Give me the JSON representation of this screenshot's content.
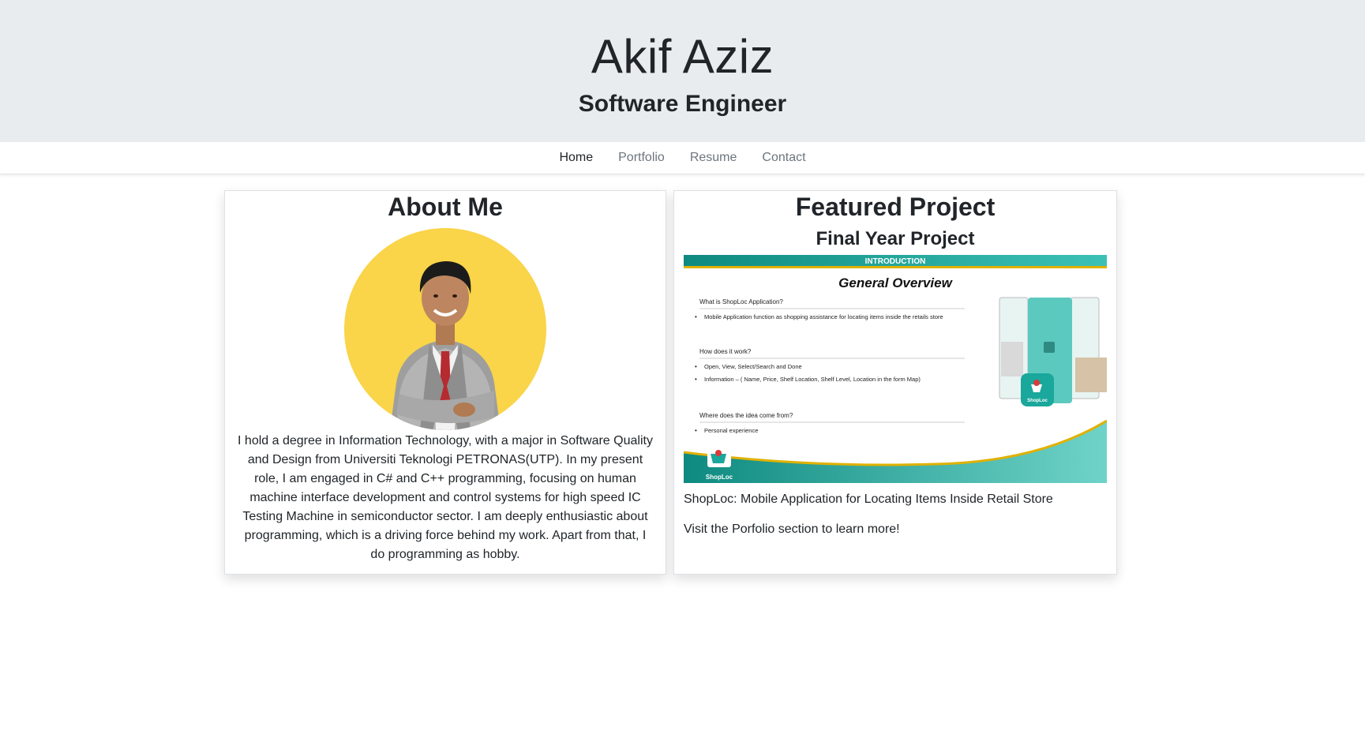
{
  "hero": {
    "name": "Akif Aziz",
    "title": "Software Engineer"
  },
  "nav": {
    "items": [
      "Home",
      "Portfolio",
      "Resume",
      "Contact"
    ],
    "active": "Home"
  },
  "about": {
    "title": "About Me",
    "text": "I hold a degree in Information Technology, with a major in Software Quality and Design from Universiti Teknologi PETRONAS(UTP). In my present role, I am engaged in C# and C++ programming, focusing on human machine interface development and control systems for high speed IC Testing Machine in semiconductor sector. I am deeply enthusiastic about programming, which is a driving force behind my work. Apart from that, I do programming as hobby."
  },
  "featured": {
    "title": "Featured Project",
    "subtitle": "Final Year Project",
    "slide": {
      "banner": "INTRODUCTION",
      "heading": "General Overview",
      "q1": "What is ShopLoc Application?",
      "a1": "Mobile Application function as shopping assistance for locating items inside the retails store",
      "q2": "How does it work?",
      "a2a": "Open, View, Select/Search and Done",
      "a2b": "Information – ( Name, Price, Shelf Location, Shelf Level, Location in the form Map)",
      "q3": "Where does the idea come from?",
      "a3": "Personal experience",
      "logo": "ShopLoc"
    },
    "description": "ShopLoc: Mobile Application for Locating Items Inside Retail Store",
    "note": "Visit the Porfolio section to learn more!"
  },
  "colors": {
    "hero_bg": "#e9ecef",
    "avatar_bg": "#fad449",
    "slide_teal": "#1aa79c",
    "slide_gold": "#e0b100"
  }
}
